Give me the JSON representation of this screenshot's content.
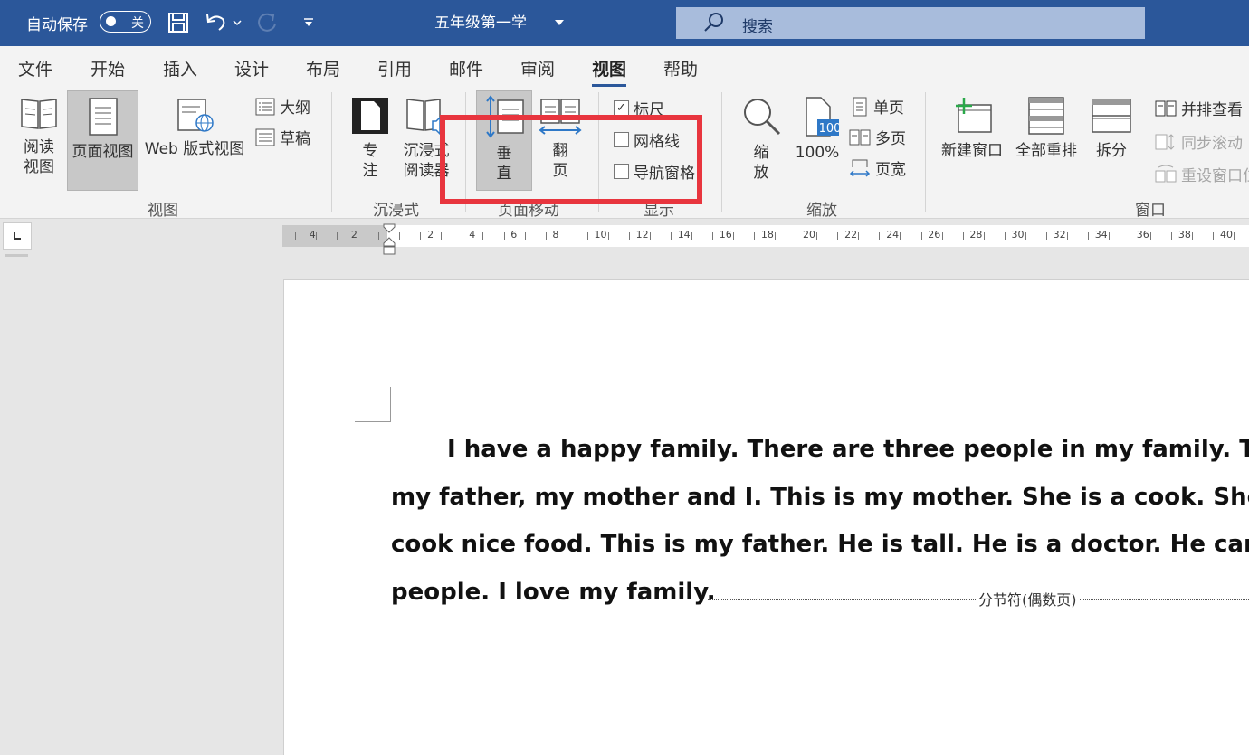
{
  "title_bar": {
    "autosave_label": "自动保存",
    "autosave_state": "关",
    "doc_title": "五年级第一学",
    "search_placeholder": "搜索"
  },
  "menu": {
    "tabs": [
      "文件",
      "开始",
      "插入",
      "设计",
      "布局",
      "引用",
      "邮件",
      "审阅",
      "视图",
      "帮助"
    ],
    "active_tab": "视图"
  },
  "ribbon": {
    "views": {
      "read_mode": "阅读\n视图",
      "print_layout": "页面视图",
      "web_layout": "Web 版式视图",
      "outline": "大纲",
      "draft": "草稿",
      "group_label": "视图"
    },
    "immersive": {
      "focus": "专\n注",
      "immersive_reader": "沉浸式\n阅读器",
      "group_label": "沉浸式"
    },
    "page_movement": {
      "vertical": "垂\n直",
      "side_to_side": "翻\n页",
      "group_label": "页面移动"
    },
    "show": {
      "ruler": "标尺",
      "ruler_checked": true,
      "gridlines": "网格线",
      "gridlines_checked": false,
      "nav_pane": "导航窗格",
      "nav_pane_checked": false,
      "group_label": "显示"
    },
    "zoom": {
      "zoom": "缩\n放",
      "hundred": "100%",
      "one_page": "单页",
      "multiple_pages": "多页",
      "page_width": "页宽",
      "group_label": "缩放"
    },
    "window": {
      "new_window": "新建窗口",
      "arrange_all": "全部重排",
      "split": "拆分",
      "side_by_side": "并排查看",
      "sync_scroll": "同步滚动",
      "reset_position": "重设窗口位",
      "group_label": "窗口"
    }
  },
  "ruler": {
    "numbers": [
      "4",
      "2",
      "2",
      "4",
      "6",
      "8",
      "10",
      "12",
      "14",
      "16",
      "18",
      "20",
      "22",
      "24",
      "26",
      "28",
      "30",
      "32",
      "34",
      "36",
      "38",
      "40"
    ]
  },
  "document": {
    "lines": [
      "I have a happy family. There are three people in my family. Th",
      "my father, my mother and I. This is my mother. She is a cook. She",
      "cook nice food. This is my father. He is tall. He is a doctor. He can",
      "people. I love my family."
    ],
    "section_break": "分节符(偶数页)"
  },
  "colors": {
    "title_bar": "#2b579a",
    "annotation": "#e8353e",
    "ribbon_bg": "#f3f3f3"
  }
}
